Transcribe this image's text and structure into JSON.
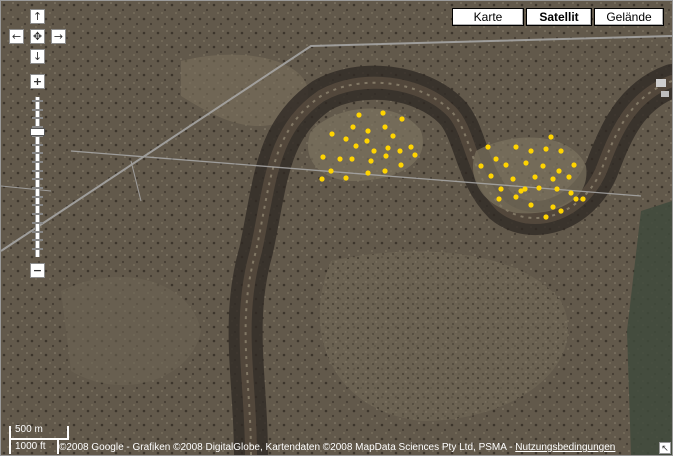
{
  "map_types": [
    {
      "label": "Karte",
      "active": false
    },
    {
      "label": "Satellit",
      "active": true
    },
    {
      "label": "Gelände",
      "active": false
    }
  ],
  "navigation": {
    "pan_up": "↑",
    "pan_left": "←",
    "center": "✥",
    "pan_right": "→",
    "pan_down": "↓",
    "zoom_in": "+",
    "zoom_out": "−"
  },
  "scale": {
    "metric": "500 m",
    "imperial": "1000 ft"
  },
  "attribution": {
    "text": "©2008 Google - Grafiken ©2008 DigitalGlobe, Kartendaten ©2008 MapData Sciences Pty Ltd, PSMA - ",
    "terms_link": "Nutzungsbedingungen"
  },
  "marker_color": "#ffd400",
  "colors": {
    "terrain_base": "#5f584b",
    "riverbank": "#3d3530",
    "road": "#a9a9a9"
  }
}
